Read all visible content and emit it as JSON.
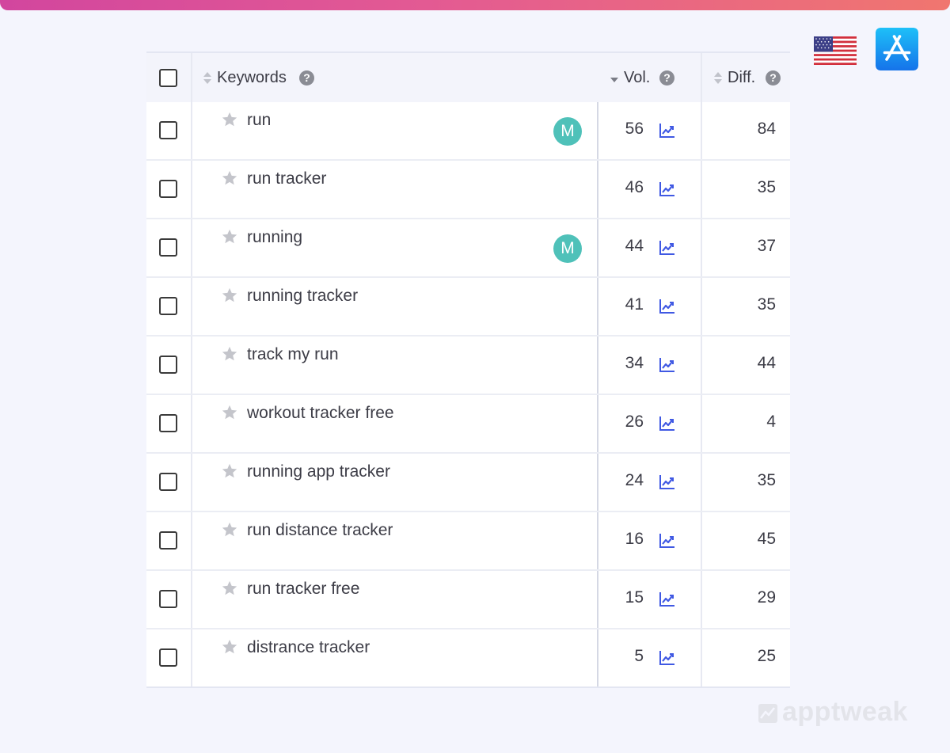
{
  "colors": {
    "accent": "#4059e3",
    "badge": "#4fc1b9",
    "star": "#c4c5cb",
    "brand": "#e3e4ea"
  },
  "toolbar": {
    "country_flag": "us-flag-icon",
    "store_icon": "app-store-icon"
  },
  "table": {
    "columns": {
      "keywords": "Keywords",
      "volume": "Vol.",
      "difficulty": "Diff."
    },
    "help_glyph": "?",
    "sort": {
      "column": "volume",
      "direction": "descending"
    },
    "rows": [
      {
        "keyword": "run",
        "badge": "M",
        "volume": "56",
        "difficulty": "84"
      },
      {
        "keyword": "run tracker",
        "badge": "",
        "volume": "46",
        "difficulty": "35"
      },
      {
        "keyword": "running",
        "badge": "M",
        "volume": "44",
        "difficulty": "37"
      },
      {
        "keyword": "running tracker",
        "badge": "",
        "volume": "41",
        "difficulty": "35"
      },
      {
        "keyword": "track my run",
        "badge": "",
        "volume": "34",
        "difficulty": "44"
      },
      {
        "keyword": "workout tracker free",
        "badge": "",
        "volume": "26",
        "difficulty": "4"
      },
      {
        "keyword": "running app tracker",
        "badge": "",
        "volume": "24",
        "difficulty": "35"
      },
      {
        "keyword": "run distance tracker",
        "badge": "",
        "volume": "16",
        "difficulty": "45"
      },
      {
        "keyword": "run tracker free",
        "badge": "",
        "volume": "15",
        "difficulty": "29"
      },
      {
        "keyword": "distrance tracker",
        "badge": "",
        "volume": "5",
        "difficulty": "25"
      }
    ]
  },
  "brand": {
    "name": "apptweak"
  }
}
